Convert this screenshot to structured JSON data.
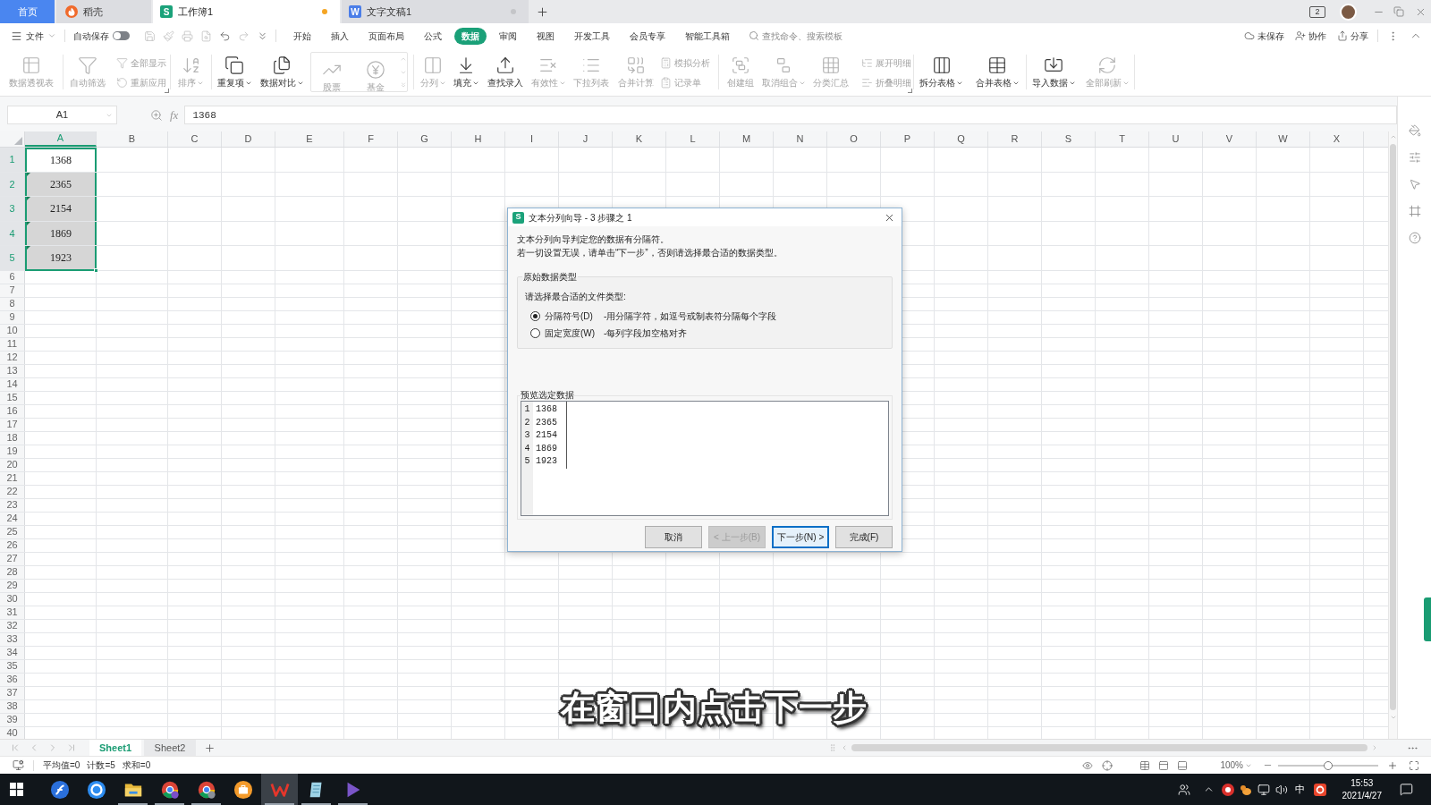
{
  "tab_bar": {
    "tabs": [
      {
        "label": "首页",
        "kind": "home",
        "selected": false
      },
      {
        "label": "稻壳",
        "kind": "docer",
        "selected": false
      },
      {
        "label": "工作簿1",
        "kind": "sheet",
        "logo": "S",
        "selected": true,
        "modified": true
      },
      {
        "label": "文字文稿1",
        "kind": "writer",
        "logo": "W",
        "selected": false,
        "modified": false
      }
    ],
    "window_count": "2"
  },
  "menu_bar": {
    "file_menu": "文件",
    "autosave": {
      "label": "自动保存",
      "on": false
    },
    "quick_access": [
      {
        "disabled": true
      },
      {
        "disabled": true
      },
      {
        "disabled": true
      },
      {
        "disabled": true
      },
      {
        "disabled": false
      },
      {
        "disabled": true
      },
      {
        "disabled": false
      }
    ],
    "tabs": [
      {
        "label": "开始",
        "selected": false
      },
      {
        "label": "插入",
        "selected": false
      },
      {
        "label": "页面布局",
        "selected": false
      },
      {
        "label": "公式",
        "selected": false
      },
      {
        "label": "数据",
        "selected": true
      },
      {
        "label": "审阅",
        "selected": false
      },
      {
        "label": "视图",
        "selected": false
      },
      {
        "label": "开发工具",
        "selected": false
      },
      {
        "label": "会员专享",
        "selected": false
      },
      {
        "label": "智能工具箱",
        "selected": false
      }
    ],
    "search": {
      "placeholder": "查找命令、搜索模板"
    },
    "actions": [
      {
        "label": "未保存",
        "kind": "cloud"
      },
      {
        "label": "协作",
        "kind": "collaborate"
      },
      {
        "label": "分享",
        "kind": "share"
      }
    ]
  },
  "ribbon": {
    "groups": [
      {
        "columns": [
          {
            "kind": "large",
            "label": "数据透视表",
            "disabled": true
          }
        ]
      },
      {
        "launcher": true,
        "columns": [
          {
            "kind": "large",
            "label": "自动筛选",
            "disabled": true
          },
          {
            "kind": "stack",
            "items": [
              {
                "label": "全部显示",
                "disabled": true
              },
              {
                "label": "重新应用",
                "disabled": true
              }
            ]
          }
        ]
      },
      {
        "columns": [
          {
            "kind": "large",
            "label": "排序",
            "disabled": true,
            "dropdown": true
          }
        ]
      },
      {
        "columns": [
          {
            "kind": "large",
            "label": "重复项",
            "disabled": false,
            "dropdown": true
          },
          {
            "kind": "large",
            "label": "数据对比",
            "disabled": false,
            "dropdown": true
          },
          {
            "kind": "gallery",
            "items": [
              {
                "label": "股票",
                "disabled": true
              },
              {
                "label": "基金",
                "disabled": true
              }
            ]
          }
        ]
      },
      {
        "columns": [
          {
            "kind": "large",
            "label": "分列",
            "disabled": true,
            "dropdown": true
          },
          {
            "kind": "large",
            "label": "填充",
            "disabled": false,
            "dropdown": true
          },
          {
            "kind": "large",
            "label": "查找录入",
            "disabled": false
          },
          {
            "kind": "large",
            "label": "有效性",
            "disabled": true,
            "dropdown": true
          },
          {
            "kind": "large",
            "label": "下拉列表",
            "disabled": true
          },
          {
            "kind": "large",
            "label": "合并计算",
            "disabled": true
          },
          {
            "kind": "stack",
            "items": [
              {
                "label": "模拟分析",
                "disabled": true
              },
              {
                "label": "记录单",
                "disabled": true
              }
            ]
          }
        ]
      },
      {
        "launcher": true,
        "columns": [
          {
            "kind": "large",
            "label": "创建组",
            "disabled": true
          },
          {
            "kind": "large",
            "label": "取消组合",
            "disabled": true,
            "dropdown": true
          },
          {
            "kind": "large",
            "label": "分类汇总",
            "disabled": true
          },
          {
            "kind": "stack",
            "items": [
              {
                "label": "展开明细",
                "disabled": true
              },
              {
                "label": "折叠明细",
                "disabled": true
              }
            ]
          }
        ]
      },
      {
        "columns": [
          {
            "kind": "large",
            "label": "拆分表格",
            "disabled": false,
            "dropdown": true
          },
          {
            "kind": "large",
            "label": "合并表格",
            "disabled": false,
            "dropdown": true
          }
        ]
      },
      {
        "columns": [
          {
            "kind": "large",
            "label": "导入数据",
            "disabled": false,
            "dropdown": true
          },
          {
            "kind": "large",
            "label": "全部刷新",
            "disabled": true,
            "dropdown": true
          }
        ]
      }
    ]
  },
  "formula_bar": {
    "cell_reference": "A1",
    "function_label": "fx",
    "value": "1368"
  },
  "sheet": {
    "columns": [
      {
        "label": "A",
        "selected": true
      },
      {
        "label": "B",
        "selected": false
      },
      {
        "label": "C",
        "selected": false
      },
      {
        "label": "D",
        "selected": false
      },
      {
        "label": "E",
        "selected": false
      },
      {
        "label": "F",
        "selected": false
      },
      {
        "label": "G",
        "selected": false
      },
      {
        "label": "H",
        "selected": false
      },
      {
        "label": "I",
        "selected": false
      },
      {
        "label": "J",
        "selected": false
      },
      {
        "label": "K",
        "selected": false
      },
      {
        "label": "L",
        "selected": false
      },
      {
        "label": "M",
        "selected": false
      },
      {
        "label": "N",
        "selected": false
      },
      {
        "label": "O",
        "selected": false
      },
      {
        "label": "P",
        "selected": false
      },
      {
        "label": "Q",
        "selected": false
      },
      {
        "label": "R",
        "selected": false
      },
      {
        "label": "S",
        "selected": false
      },
      {
        "label": "T",
        "selected": false
      },
      {
        "label": "U",
        "selected": false
      },
      {
        "label": "V",
        "selected": false
      },
      {
        "label": "W",
        "selected": false
      },
      {
        "label": "X",
        "selected": false
      }
    ],
    "rows": [
      {
        "number": "1",
        "selected": true,
        "cells": [
          {
            "value": "1368",
            "active": true,
            "selected": true,
            "flag": false
          }
        ]
      },
      {
        "number": "2",
        "selected": true,
        "cells": [
          {
            "value": "2365",
            "active": false,
            "selected": true,
            "flag": true
          }
        ]
      },
      {
        "number": "3",
        "selected": true,
        "cells": [
          {
            "value": "2154",
            "active": false,
            "selected": true,
            "flag": true
          }
        ]
      },
      {
        "number": "4",
        "selected": true,
        "cells": [
          {
            "value": "1869",
            "active": false,
            "selected": true,
            "flag": true
          }
        ]
      },
      {
        "number": "5",
        "selected": true,
        "cells": [
          {
            "value": "1923",
            "active": false,
            "selected": true,
            "flag": true
          }
        ]
      },
      {
        "number": "6",
        "selected": false
      },
      {
        "number": "7",
        "selected": false
      },
      {
        "number": "8",
        "selected": false
      },
      {
        "number": "9",
        "selected": false
      },
      {
        "number": "10",
        "selected": false
      },
      {
        "number": "11",
        "selected": false
      },
      {
        "number": "12",
        "selected": false
      },
      {
        "number": "13",
        "selected": false
      },
      {
        "number": "14",
        "selected": false
      },
      {
        "number": "15",
        "selected": false
      },
      {
        "number": "16",
        "selected": false
      },
      {
        "number": "17",
        "selected": false
      },
      {
        "number": "18",
        "selected": false
      },
      {
        "number": "19",
        "selected": false
      },
      {
        "number": "20",
        "selected": false
      },
      {
        "number": "21",
        "selected": false
      },
      {
        "number": "22",
        "selected": false
      },
      {
        "number": "23",
        "selected": false
      },
      {
        "number": "24",
        "selected": false
      },
      {
        "number": "25",
        "selected": false
      },
      {
        "number": "26",
        "selected": false
      },
      {
        "number": "27",
        "selected": false
      },
      {
        "number": "28",
        "selected": false
      },
      {
        "number": "29",
        "selected": false
      },
      {
        "number": "30",
        "selected": false
      },
      {
        "number": "31",
        "selected": false
      },
      {
        "number": "32",
        "selected": false
      },
      {
        "number": "33",
        "selected": false
      },
      {
        "number": "34",
        "selected": false
      },
      {
        "number": "35",
        "selected": false
      },
      {
        "number": "36",
        "selected": false
      },
      {
        "number": "37",
        "selected": false
      },
      {
        "number": "38",
        "selected": false
      },
      {
        "number": "39",
        "selected": false
      },
      {
        "number": "40",
        "selected": false
      }
    ]
  },
  "sheet_tabs": [
    {
      "label": "Sheet1",
      "selected": true
    },
    {
      "label": "Sheet2",
      "selected": false
    }
  ],
  "status_bar": {
    "stats": [
      "平均值=0",
      "计数=5",
      "求和=0"
    ],
    "zoom": "100%",
    "zoom_slider": {
      "level": 0.5
    }
  },
  "taskbar": {
    "apps": [
      {
        "running": false,
        "active": false
      },
      {
        "running": false,
        "active": false
      },
      {
        "running": true,
        "active": false
      },
      {
        "running": true,
        "active": false
      },
      {
        "running": true,
        "active": false
      },
      {
        "running": false,
        "active": false
      },
      {
        "running": true,
        "active": true
      },
      {
        "running": true,
        "active": false
      },
      {
        "running": true,
        "active": false
      }
    ],
    "input_method": "中",
    "time": "15:53",
    "date": "2021/4/27"
  },
  "dialog": {
    "logo": "S",
    "title": "文本分列向导 - 3 步骤之 1",
    "intro": [
      "文本分列向导判定您的数据有分隔符。",
      "若一切设置无误，请单击“下一步”，否则请选择最合适的数据类型。"
    ],
    "group_title": "原始数据类型",
    "prompt": "请选择最合适的文件类型:",
    "options": [
      {
        "label": "分隔符号(D)",
        "description": "-用分隔字符，如逗号或制表符分隔每个字段",
        "selected": true
      },
      {
        "label": "固定宽度(W)",
        "description": "-每列字段加空格对齐",
        "selected": false
      }
    ],
    "preview_title": "预览选定数据",
    "preview_lines": [
      {
        "number": "1",
        "text": "1368"
      },
      {
        "number": "2",
        "text": "2365"
      },
      {
        "number": "3",
        "text": "2154"
      },
      {
        "number": "4",
        "text": "1869"
      },
      {
        "number": "5",
        "text": "1923"
      }
    ],
    "buttons": [
      {
        "label": "取消",
        "disabled": false,
        "default": false
      },
      {
        "label": "< 上一步(B)",
        "disabled": true,
        "default": false
      },
      {
        "label": "下一步(N) >",
        "disabled": false,
        "default": true
      },
      {
        "label": "完成(F)",
        "disabled": false,
        "default": false
      }
    ]
  },
  "caption": "在窗口内点击下一步"
}
